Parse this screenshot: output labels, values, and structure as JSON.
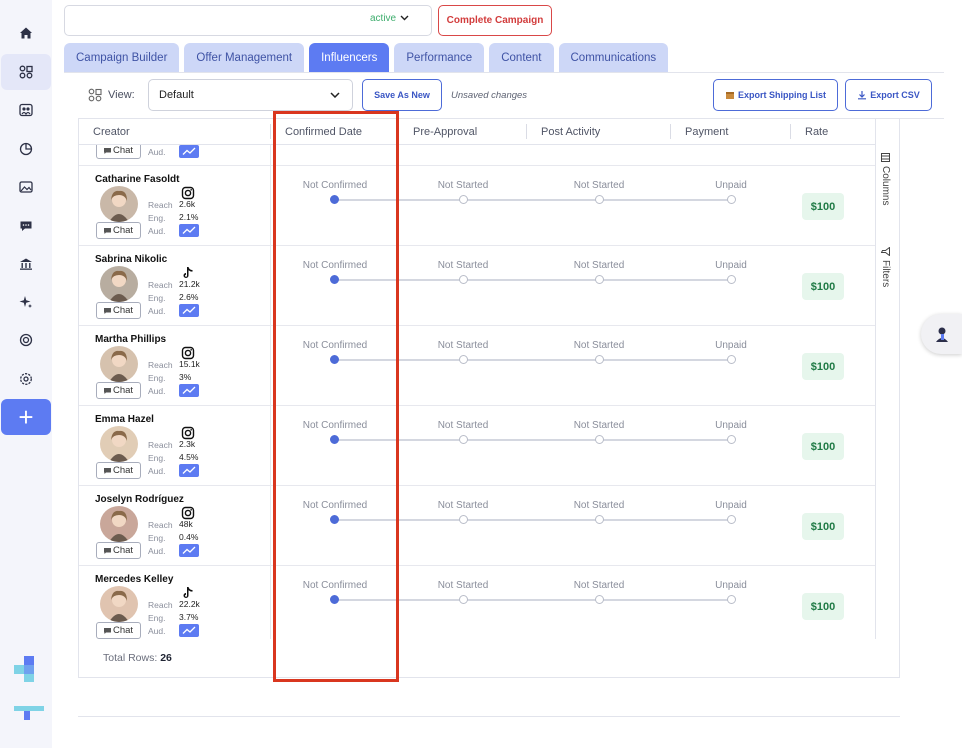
{
  "header": {
    "status": "active",
    "complete_label": "Complete Campaign"
  },
  "tabs": [
    "Campaign Builder",
    "Offer Management",
    "Influencers",
    "Performance",
    "Content",
    "Communications"
  ],
  "toolbar": {
    "view_label": "View:",
    "view_value": "Default",
    "save_as_new": "Save As New",
    "unsaved": "Unsaved changes",
    "export_shipping": "Export Shipping List",
    "export_csv": "Export CSV"
  },
  "columns": {
    "creator": "Creator",
    "confirmed_date": "Confirmed Date",
    "pre_approval": "Pre-Approval",
    "post_activity": "Post Activity",
    "payment": "Payment",
    "rate": "Rate"
  },
  "side_panel": {
    "columns": "Columns",
    "filters": "Filters"
  },
  "labels": {
    "reach": "Reach",
    "eng": "Eng.",
    "aud": "Aud.",
    "chat": "Chat"
  },
  "partial_row": {
    "chat": "Chat",
    "aud": "Aud."
  },
  "rows": [
    {
      "name": "Catharine Fasoldt",
      "platform": "instagram",
      "reach": "2.6k",
      "eng": "2.1%",
      "confirmed": "Not Confirmed",
      "pre": "Not Started",
      "post": "Not Started",
      "payment": "Unpaid",
      "rate": "$100"
    },
    {
      "name": "Sabrina Nikolic",
      "platform": "tiktok",
      "reach": "21.2k",
      "eng": "2.6%",
      "confirmed": "Not Confirmed",
      "pre": "Not Started",
      "post": "Not Started",
      "payment": "Unpaid",
      "rate": "$100"
    },
    {
      "name": "Martha Phillips",
      "platform": "instagram",
      "reach": "15.1k",
      "eng": "3%",
      "confirmed": "Not Confirmed",
      "pre": "Not Started",
      "post": "Not Started",
      "payment": "Unpaid",
      "rate": "$100"
    },
    {
      "name": "Emma Hazel",
      "platform": "instagram",
      "reach": "2.3k",
      "eng": "4.5%",
      "confirmed": "Not Confirmed",
      "pre": "Not Started",
      "post": "Not Started",
      "payment": "Unpaid",
      "rate": "$100"
    },
    {
      "name": "Joselyn Rodríguez",
      "platform": "instagram",
      "reach": "48k",
      "eng": "0.4%",
      "confirmed": "Not Confirmed",
      "pre": "Not Started",
      "post": "Not Started",
      "payment": "Unpaid",
      "rate": "$100"
    },
    {
      "name": "Mercedes Kelley",
      "platform": "tiktok",
      "reach": "22.2k",
      "eng": "3.7%",
      "confirmed": "Not Confirmed",
      "pre": "Not Started",
      "post": "Not Started",
      "payment": "Unpaid",
      "rate": "$100"
    }
  ],
  "footer": {
    "total_label": "Total Rows:",
    "total_value": "26"
  },
  "colors": {
    "accent": "#5d7bf2",
    "danger": "#d23c3c",
    "success": "#1f7a45",
    "highlight_box": "#d9361f"
  }
}
